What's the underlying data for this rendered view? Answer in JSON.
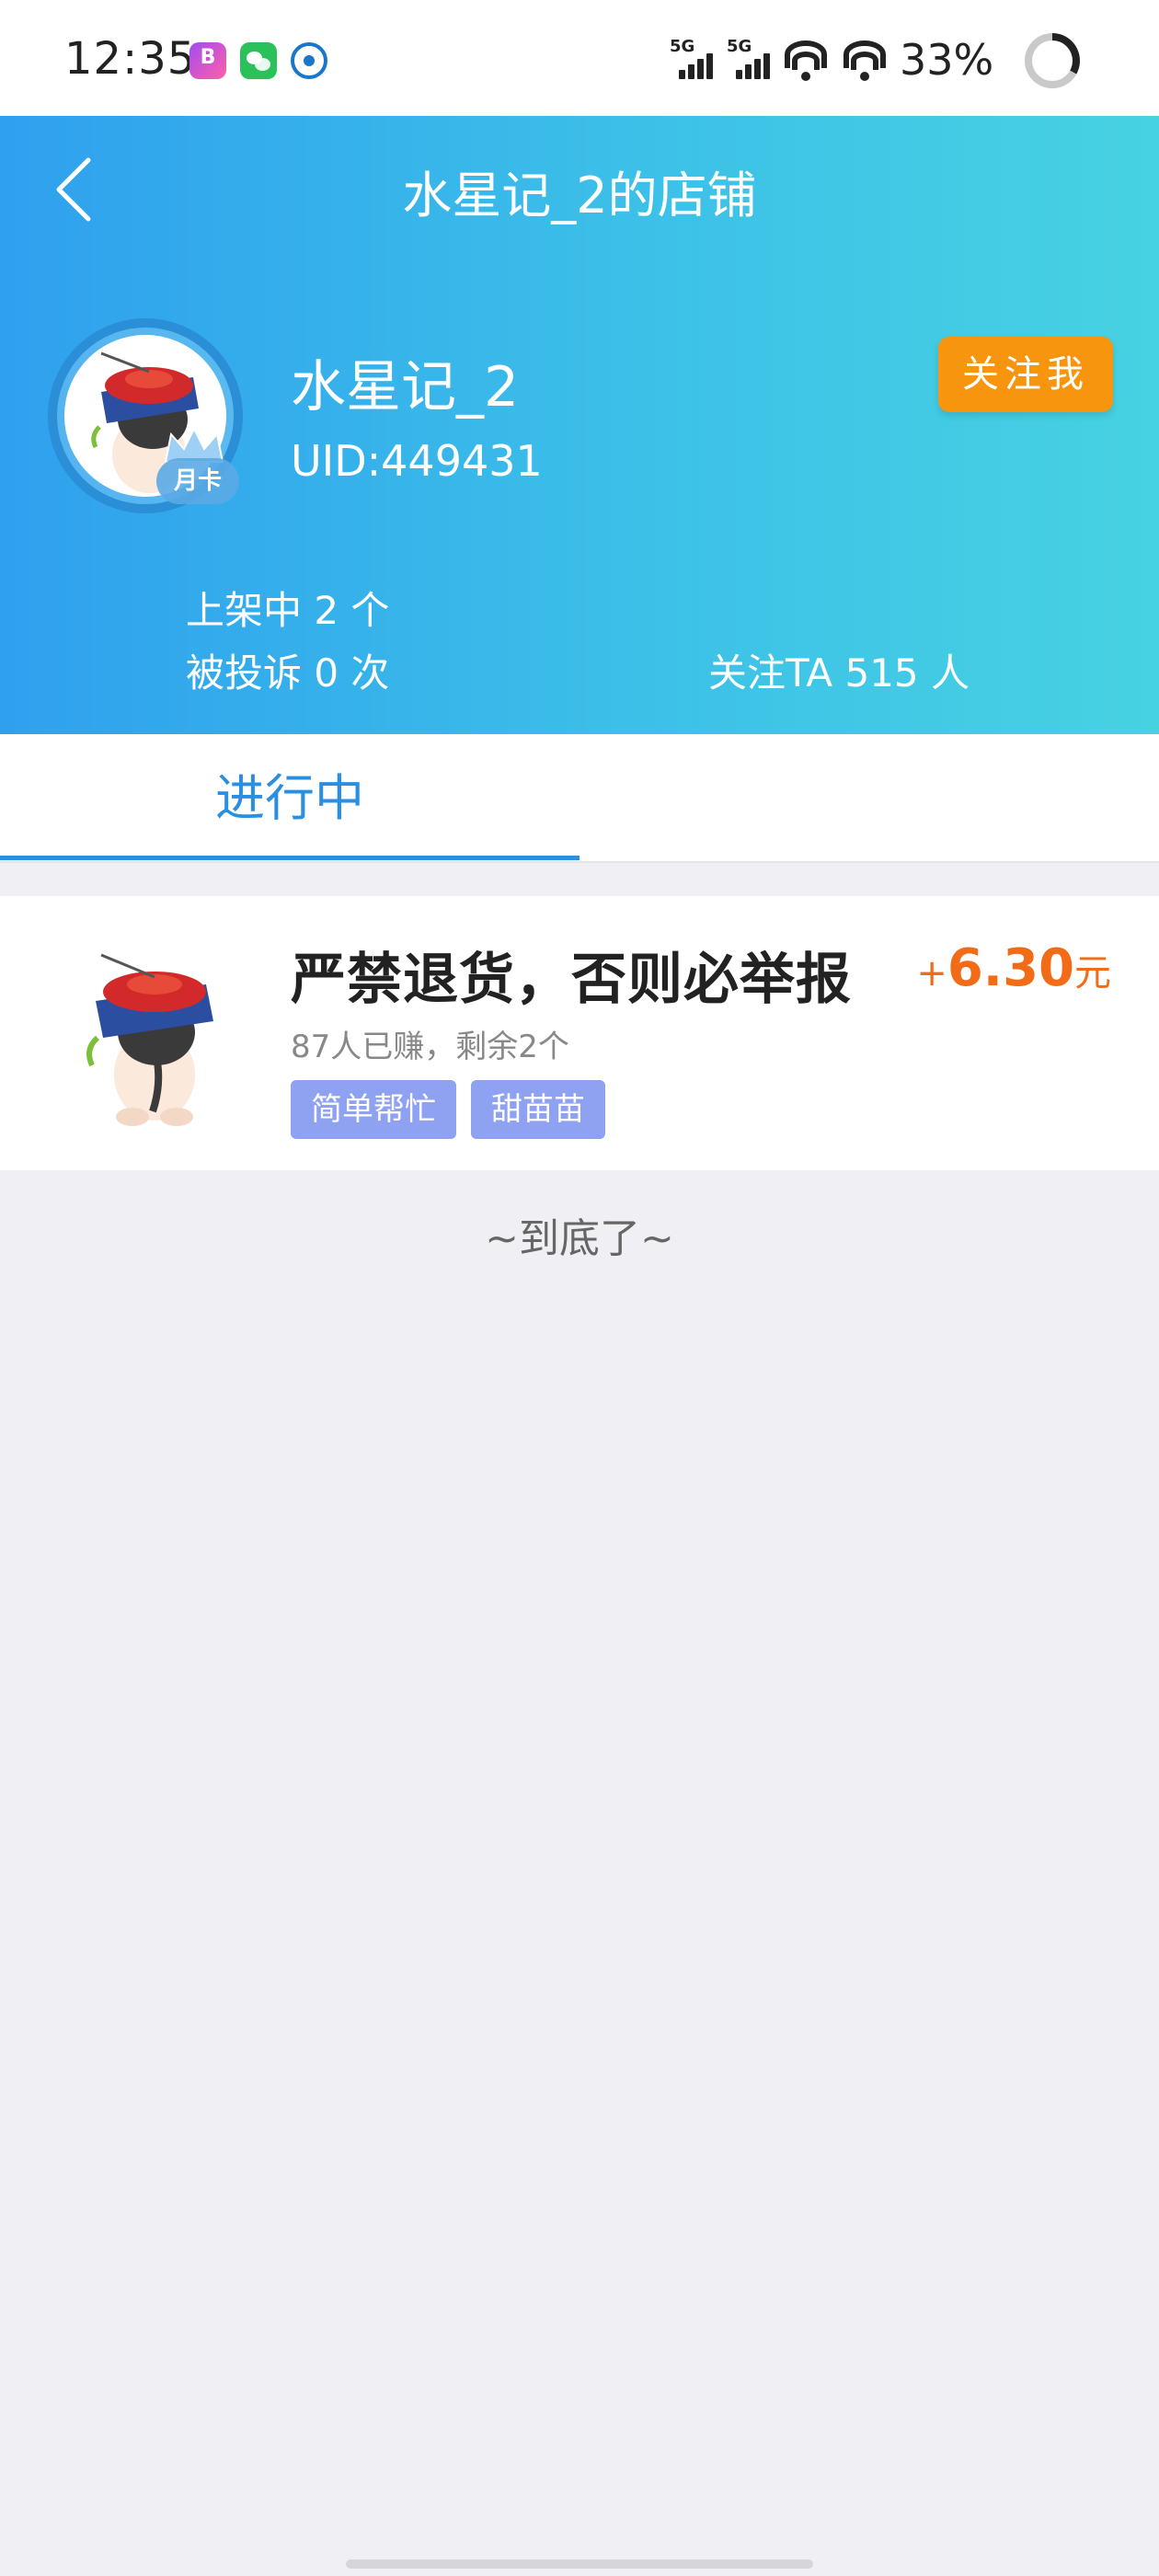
{
  "status_bar": {
    "time": "12:35",
    "network_1": "5G",
    "network_2": "5G",
    "battery": "33%",
    "icons": [
      "bank-app-icon",
      "wechat-icon",
      "cmb-icon",
      "signal-icon",
      "wifi-icon",
      "battery-icon"
    ]
  },
  "header": {
    "title": "水星记_2的店铺",
    "back_icon": "chevron-left-icon",
    "username": "水星记_2",
    "uid": "UID:449431",
    "vip_badge": "月卡",
    "follow_label": "关注我",
    "stats": {
      "listed": "上架中 2 个",
      "complaints": "被投诉 0 次",
      "followers": "关注TA 515 人"
    }
  },
  "tabs": [
    {
      "label": "进行中",
      "active": true
    }
  ],
  "tasks": [
    {
      "title": "严禁退货，否则必举报",
      "price_prefix": "+",
      "price": "6.30",
      "price_unit": "元",
      "meta": "87人已赚，剩余2个",
      "tags": [
        "简单帮忙",
        "甜苗苗"
      ]
    }
  ],
  "end_text": "~到底了~",
  "colors": {
    "header_gradient_start": "#2fa0ee",
    "header_gradient_end": "#47d2e2",
    "accent_blue": "#2a8fe0",
    "follow_button": "#f7950f",
    "price": "#f26b16",
    "tag": "#8fa2f2",
    "page_background": "#efeff4"
  }
}
